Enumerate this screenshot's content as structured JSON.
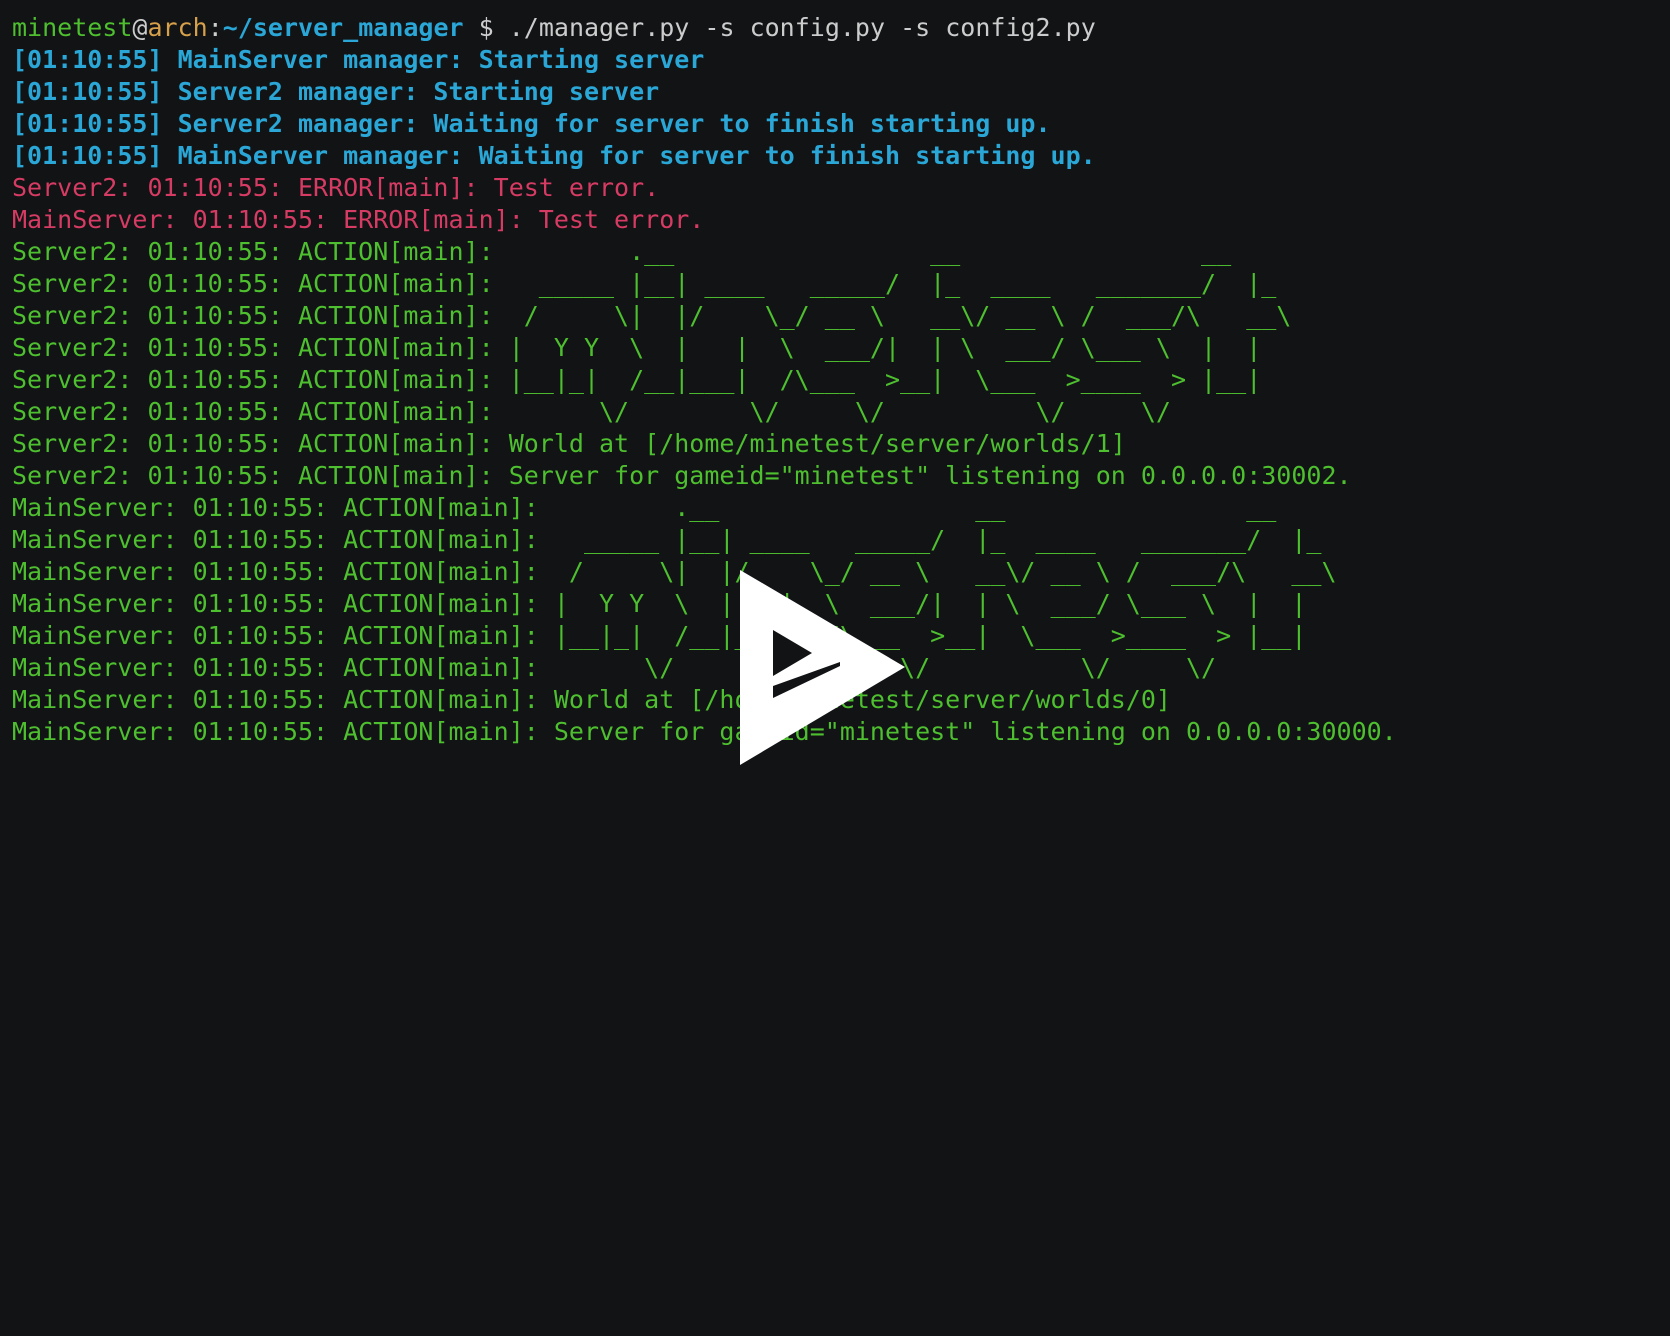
{
  "prompt": {
    "user": "minetest",
    "at": "@",
    "host": "arch",
    "colon": ":",
    "path": "~/server_manager",
    "command": " $ ./manager.py -s config.py -s config2.py"
  },
  "lines": [
    {
      "type": "info",
      "text": "[01:10:55] MainServer manager: Starting server"
    },
    {
      "type": "info",
      "text": "[01:10:55] Server2 manager: Starting server"
    },
    {
      "type": "info",
      "text": "[01:10:55] Server2 manager: Waiting for server to finish starting up."
    },
    {
      "type": "info",
      "text": "[01:10:55] MainServer manager: Waiting for server to finish starting up."
    },
    {
      "type": "error",
      "text": "Server2: 01:10:55: ERROR[main]: Test error."
    },
    {
      "type": "error",
      "text": "MainServer: 01:10:55: ERROR[main]: Test error."
    },
    {
      "type": "action",
      "text": "Server2: 01:10:55: ACTION[main]:         .__                 __                __"
    },
    {
      "type": "action",
      "text": "Server2: 01:10:55: ACTION[main]:   _____ |__| ____   _____/  |_  ____   _______/  |_"
    },
    {
      "type": "action",
      "text": "Server2: 01:10:55: ACTION[main]:  /     \\|  |/    \\_/ __ \\   __\\/ __ \\ /  ___/\\   __\\"
    },
    {
      "type": "action",
      "text": "Server2: 01:10:55: ACTION[main]: |  Y Y  \\  |   |  \\  ___/|  | \\  ___/ \\___ \\  |  |"
    },
    {
      "type": "action",
      "text": "Server2: 01:10:55: ACTION[main]: |__|_|  /__|___|  /\\___  >__|  \\___  >____  > |__|"
    },
    {
      "type": "action",
      "text": "Server2: 01:10:55: ACTION[main]:       \\/        \\/     \\/          \\/     \\/"
    },
    {
      "type": "action",
      "text": "Server2: 01:10:55: ACTION[main]: World at [/home/minetest/server/worlds/1]"
    },
    {
      "type": "action",
      "text": "Server2: 01:10:55: ACTION[main]: Server for gameid=\"minetest\" listening on 0.0.0.0:30002."
    },
    {
      "type": "action",
      "text": "MainServer: 01:10:55: ACTION[main]:         .__                 __                __"
    },
    {
      "type": "action",
      "text": "MainServer: 01:10:55: ACTION[main]:   _____ |__| ____   _____/  |_  ____   _______/  |_"
    },
    {
      "type": "action",
      "text": "MainServer: 01:10:55: ACTION[main]:  /     \\|  |/    \\_/ __ \\   __\\/ __ \\ /  ___/\\   __\\"
    },
    {
      "type": "action",
      "text": "MainServer: 01:10:55: ACTION[main]: |  Y Y  \\  |   |  \\  ___/|  | \\  ___/ \\___ \\  |  |"
    },
    {
      "type": "action",
      "text": "MainServer: 01:10:55: ACTION[main]: |__|_|  /__|___|  /\\___  >__|  \\___  >____  > |__|"
    },
    {
      "type": "action",
      "text": "MainServer: 01:10:55: ACTION[main]:       \\/        \\/     \\/          \\/     \\/"
    },
    {
      "type": "action",
      "text": "MainServer: 01:10:55: ACTION[main]: World at [/home/minetest/server/worlds/0]"
    },
    {
      "type": "action",
      "text": "MainServer: 01:10:55: ACTION[main]: Server for gameid=\"minetest\" listening on 0.0.0.0:30000."
    }
  ],
  "overlay": {
    "icon": "asciinema-play-icon"
  },
  "colors": {
    "background": "#111315",
    "info": "#2aa7d6",
    "error": "#d63b63",
    "action": "#4ebf2f",
    "host": "#d7a04a",
    "default": "#cccccc"
  }
}
